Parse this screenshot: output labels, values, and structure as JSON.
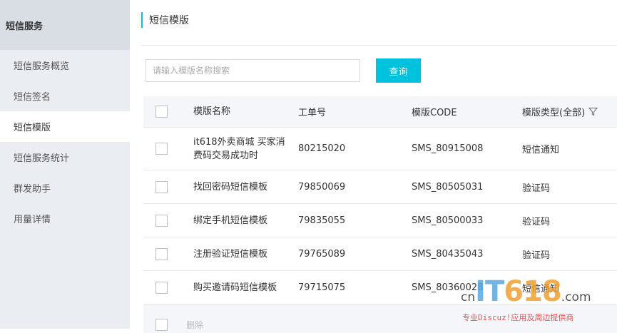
{
  "sidebar": {
    "header": "短信服务",
    "items": [
      {
        "label": "短信服务概览",
        "active": false
      },
      {
        "label": "短信签名",
        "active": false
      },
      {
        "label": "短信模版",
        "active": true
      },
      {
        "label": "短信服务统计",
        "active": false
      },
      {
        "label": "群发助手",
        "active": false
      },
      {
        "label": "用量详情",
        "active": false
      }
    ]
  },
  "main": {
    "title": "短信模版",
    "search": {
      "placeholder": "请输入模版名称搜索",
      "value": "",
      "button_label": "查询"
    },
    "table": {
      "headers": {
        "name": "模版名称",
        "order_no": "工单号",
        "code": "模版CODE",
        "type": "模版类型(全部)"
      },
      "rows": [
        {
          "name": "it618外卖商城 买家消费码交易成功时",
          "order_no": "80215020",
          "code": "SMS_80915008",
          "type": "短信通知"
        },
        {
          "name": "找回密码短信模板",
          "order_no": "79850069",
          "code": "SMS_80505031",
          "type": "验证码"
        },
        {
          "name": "绑定手机短信模板",
          "order_no": "79835055",
          "code": "SMS_80500033",
          "type": "验证码"
        },
        {
          "name": "注册验证短信模板",
          "order_no": "79765089",
          "code": "SMS_80435043",
          "type": "验证码"
        },
        {
          "name": "购买邀请码短信模板",
          "order_no": "79715075",
          "code": "SMS_80360028",
          "type": "短信通知"
        }
      ],
      "footer": {
        "delete_label": "删除"
      }
    }
  },
  "watermark": {
    "cn": "cn",
    "it": "IT",
    "num": "618",
    "com": ".com",
    "tagline": "专业Discuz!应用及周边提供商"
  },
  "colors": {
    "accent": "#00c1de",
    "sidebar_bg": "#eaedf1",
    "sidebar_header_bg": "#d9dee4",
    "table_header_bg": "#f5f6fa"
  }
}
